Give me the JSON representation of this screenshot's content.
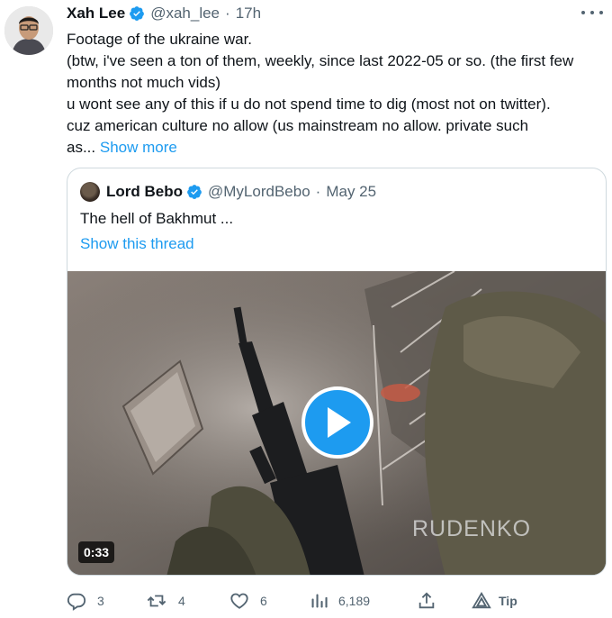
{
  "tweet": {
    "author_name": "Xah Lee",
    "handle": "@xah_lee",
    "separator": "·",
    "time": "17h",
    "text_lines": [
      "Footage of the ukraine war.",
      "(btw, i've seen a ton of them, weekly, since last 2022-05 or so. (the first few",
      "months not much vids)",
      "u wont see any of this if u do not spend time to dig (most not on twitter).",
      "cuz american culture no allow (us mainstream no allow. private such",
      "as..."
    ],
    "show_more_label": "Show more",
    "icons": {
      "verified": "verified-badge-icon",
      "more": "more-options-icon"
    }
  },
  "quote": {
    "author_name": "Lord Bebo",
    "handle": "@MyLordBebo",
    "separator": "·",
    "date": "May 25",
    "text": "The hell of Bakhmut ...",
    "show_thread_label": "Show this thread",
    "video": {
      "duration": "0:33",
      "watermark": "RUDENKO",
      "play_icon": "play-icon"
    }
  },
  "actions": {
    "replies": "3",
    "retweets": "4",
    "likes": "6",
    "views": "6,189",
    "tip_label": "Tip",
    "icons": [
      "reply-icon",
      "retweet-icon",
      "like-icon",
      "views-icon",
      "share-icon",
      "tip-icon"
    ]
  },
  "colors": {
    "accent": "#1d9bf0",
    "text": "#0f1419",
    "secondary": "#536471",
    "border": "#cfd9de"
  }
}
